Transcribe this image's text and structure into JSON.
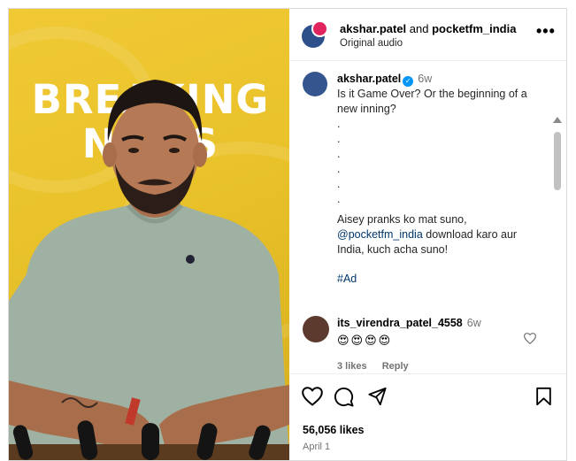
{
  "media": {
    "overlay_line1": "BREAKING",
    "overlay_line2": "NEWS"
  },
  "header": {
    "user1": "akshar.patel",
    "conjunction": "and",
    "user2": "pocketfm_india",
    "audio": "Original audio",
    "more": "•••"
  },
  "caption": {
    "username": "akshar.patel",
    "time": "6w",
    "lines": [
      "Is it Game Over? Or the beginning of a",
      "new inning?",
      ".",
      ".",
      ".",
      ".",
      ".",
      ".",
      "Aisey pranks ko mat suno,"
    ],
    "mention": "@pocketfm_india",
    "mention_tail": " download karo aur",
    "line_after": "India, kuch acha suno!",
    "hashtag": "#Ad"
  },
  "comment": {
    "username": "its_virendra_patel_4558",
    "time": "6w",
    "emojis": "😍😍😍😍",
    "likes": "3 likes",
    "reply": "Reply"
  },
  "footer": {
    "likes": "56,056 likes",
    "date": "April 1"
  },
  "icons": {
    "like": "heart-icon",
    "comment": "comment-icon",
    "share": "share-icon",
    "save": "bookmark-icon",
    "verified": "verified-badge-icon"
  },
  "colors": {
    "link": "#00376b",
    "verified": "#0095f6",
    "media_background": "#e9c22a"
  }
}
